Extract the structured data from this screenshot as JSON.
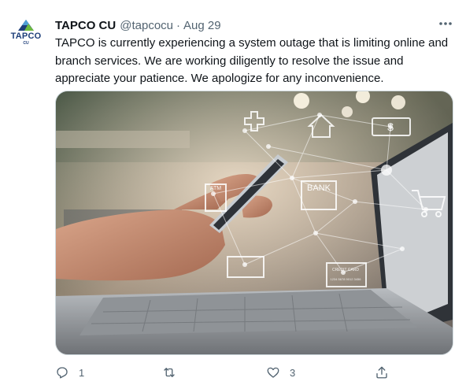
{
  "tweet": {
    "avatar": {
      "brand": "TAPCO",
      "brand_sub": "CU",
      "icon": "tapco-logo-icon"
    },
    "author_name": "TAPCO CU",
    "handle": "@tapcocu",
    "separator": "·",
    "date": "Aug 29",
    "text": "TAPCO is currently experiencing a system outage that is limiting online and branch services. We are working diligently to resolve the issue and appreciate your patience. We apologize for any inconvenience.",
    "media": {
      "icon": "photo-hand-phone-network",
      "labels": {
        "atm": "ATM",
        "bank": "BANK",
        "card": "CREDIT CARD",
        "card_num": "1234 5678 9012 3456",
        "currency": "$"
      }
    },
    "actions": {
      "reply": {
        "icon": "reply-icon",
        "count": "1"
      },
      "retweet": {
        "icon": "retweet-icon",
        "count": ""
      },
      "like": {
        "icon": "heart-icon",
        "count": "3"
      },
      "share": {
        "icon": "share-icon"
      }
    },
    "colors": {
      "text": "#0f1419",
      "secondary": "#536471",
      "brand": "#1e3f7a"
    }
  }
}
